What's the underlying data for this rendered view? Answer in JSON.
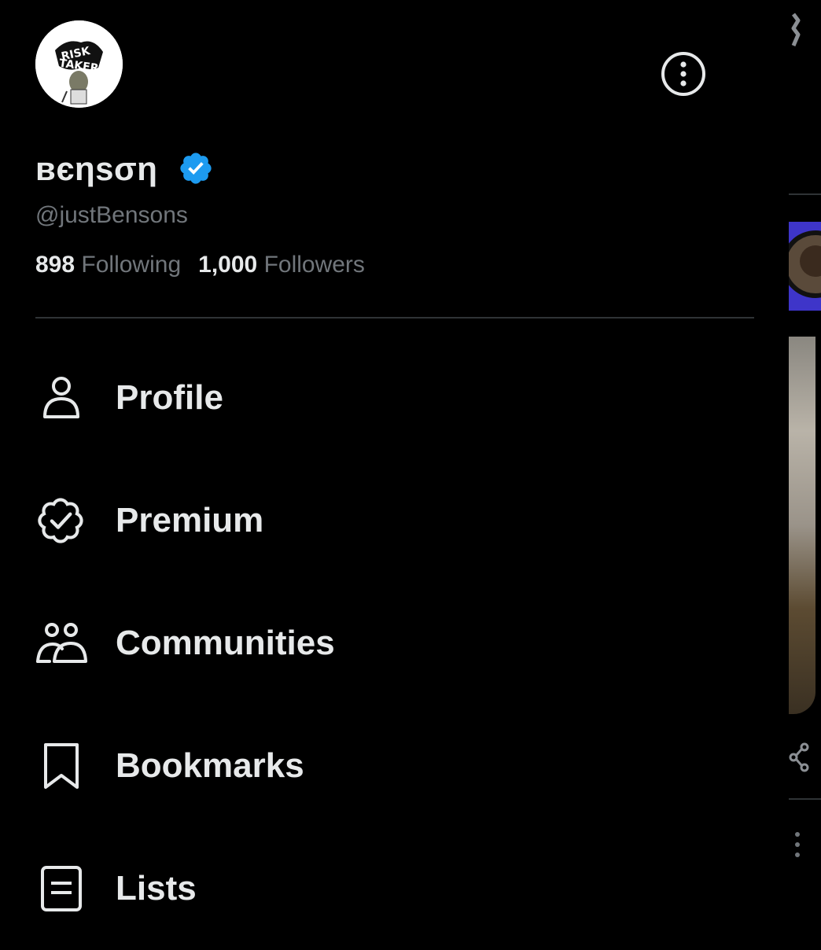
{
  "profile": {
    "display_name": "вєηѕση",
    "handle": "@justBensons",
    "verified": true,
    "following_count": "898",
    "following_label": "Following",
    "followers_count": "1,000",
    "followers_label": "Followers",
    "avatar_logo_text": "RISK TAKERS"
  },
  "menu": {
    "items": [
      {
        "label": "Profile",
        "icon": "person-icon"
      },
      {
        "label": "Premium",
        "icon": "verified-badge-icon"
      },
      {
        "label": "Communities",
        "icon": "people-icon"
      },
      {
        "label": "Bookmarks",
        "icon": "bookmark-icon"
      },
      {
        "label": "Lists",
        "icon": "list-icon"
      }
    ]
  },
  "colors": {
    "background": "#000000",
    "text_primary": "#e7e9ea",
    "text_secondary": "#71767b",
    "verified_blue": "#1d9bf0",
    "divider": "#2f3336"
  }
}
